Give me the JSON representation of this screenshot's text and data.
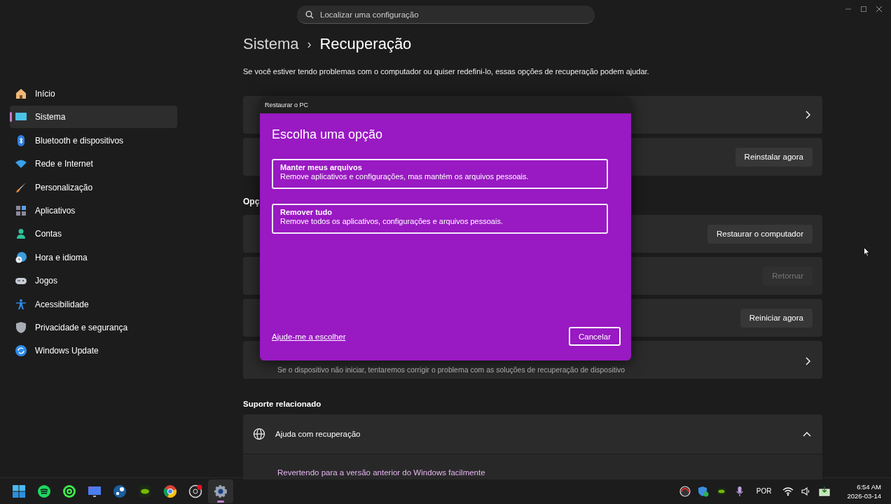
{
  "search": {
    "placeholder": "Localizar uma configuração"
  },
  "sidebar": {
    "items": [
      {
        "label": "Início",
        "selected": false
      },
      {
        "label": "Sistema",
        "selected": true
      },
      {
        "label": "Bluetooth e dispositivos",
        "selected": false
      },
      {
        "label": "Rede e Internet",
        "selected": false
      },
      {
        "label": "Personalização",
        "selected": false
      },
      {
        "label": "Aplicativos",
        "selected": false
      },
      {
        "label": "Contas",
        "selected": false
      },
      {
        "label": "Hora e idioma",
        "selected": false
      },
      {
        "label": "Jogos",
        "selected": false
      },
      {
        "label": "Acessibilidade",
        "selected": false
      },
      {
        "label": "Privacidade e segurança",
        "selected": false
      },
      {
        "label": "Windows Update",
        "selected": false
      }
    ]
  },
  "breadcrumb": {
    "parent": "Sistema",
    "separator": "›",
    "current": "Recuperação"
  },
  "description": "Se você estiver tendo problemas com o computador ou quiser redefini-lo, essas opções de recuperação podem ajudar.",
  "cards_top": [
    {
      "kind": "chevron"
    },
    {
      "kind": "button",
      "button": "Reinstalar agora",
      "disabled": false
    }
  ],
  "section_heading": "Opç",
  "cards_options": [
    {
      "kind": "button",
      "button": "Restaurar o computador",
      "disabled": false
    },
    {
      "kind": "button",
      "button": "Retornar",
      "disabled": true
    },
    {
      "kind": "button",
      "button": "Reiniciar agora",
      "disabled": false
    },
    {
      "kind": "chevron",
      "description": "Se o dispositivo não iniciar, tentaremos corrigir o problema com as soluções de recuperação de dispositivo"
    }
  ],
  "related": {
    "heading": "Suporte relacionado",
    "title": "Ajuda com recuperação",
    "expanded": true,
    "links": [
      "Revertendo para a versão anterior do Windows facilmente"
    ]
  },
  "dialog": {
    "title": "Restaurar o PC",
    "heading": "Escolha uma opção",
    "options": [
      {
        "title": "Manter meus arquivos",
        "text": "Remove aplicativos e configurações, mas mantém os arquivos pessoais."
      },
      {
        "title": "Remover tudo",
        "text": "Remove todos os aplicativos, configurações e arquivos pessoais."
      }
    ],
    "help_link": "Ajude-me a escolher",
    "cancel": "Cancelar"
  },
  "taskbar": {
    "apps": [
      {
        "selected": false
      },
      {
        "selected": false
      },
      {
        "selected": false
      },
      {
        "selected": false
      },
      {
        "selected": false
      },
      {
        "selected": false
      },
      {
        "selected": false
      },
      {
        "selected": false
      },
      {
        "selected": true
      }
    ],
    "language": "POR",
    "time": "6:54 AM",
    "date": "2026-03-14"
  }
}
